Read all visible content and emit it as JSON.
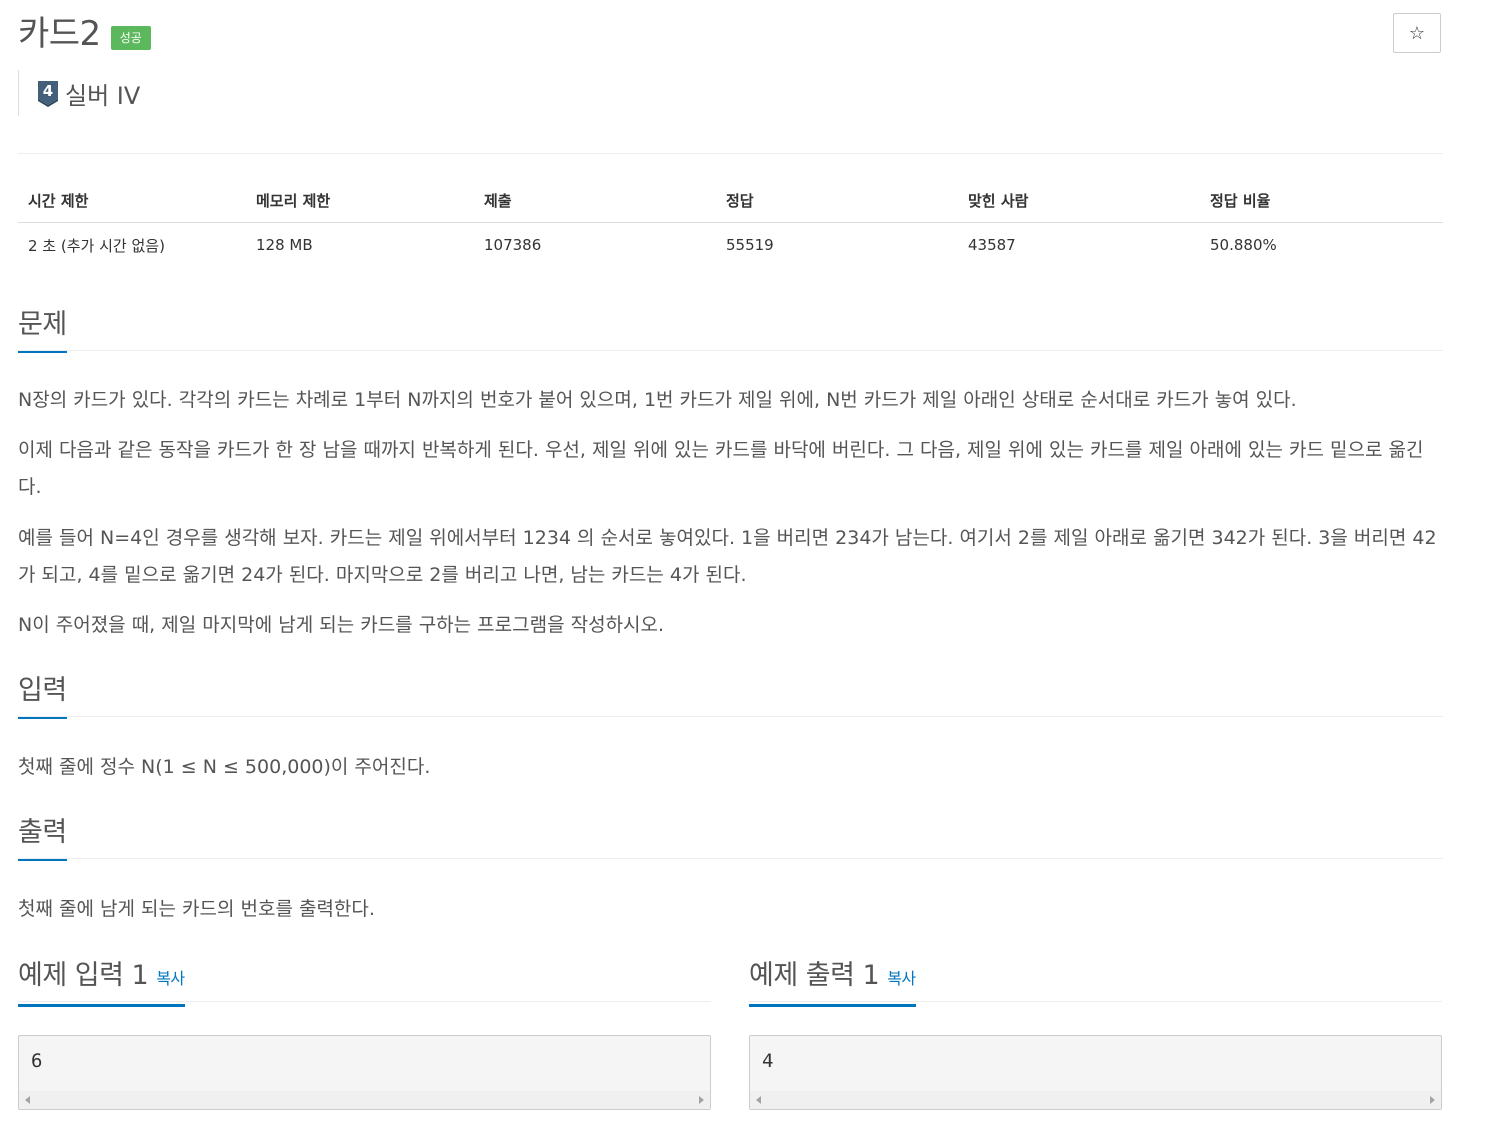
{
  "problem": {
    "title": "카드2",
    "status_badge": "성공",
    "star_icon": "☆",
    "tier": {
      "number": "4",
      "label": "실버 IV"
    }
  },
  "info_table": {
    "headers": [
      "시간 제한",
      "메모리 제한",
      "제출",
      "정답",
      "맞힌 사람",
      "정답 비율"
    ],
    "values": [
      "2 초 (추가 시간 없음)",
      "128 MB",
      "107386",
      "55519",
      "43587",
      "50.880%"
    ]
  },
  "sections": {
    "problem": {
      "title": "문제",
      "paragraphs": [
        "N장의 카드가 있다. 각각의 카드는 차례로 1부터 N까지의 번호가 붙어 있으며, 1번 카드가 제일 위에, N번 카드가 제일 아래인 상태로 순서대로 카드가 놓여 있다.",
        "이제 다음과 같은 동작을 카드가 한 장 남을 때까지 반복하게 된다. 우선, 제일 위에 있는 카드를 바닥에 버린다. 그 다음, 제일 위에 있는 카드를 제일 아래에 있는 카드 밑으로 옮긴다.",
        "예를 들어 N=4인 경우를 생각해 보자. 카드는 제일 위에서부터 1234 의 순서로 놓여있다. 1을 버리면 234가 남는다. 여기서 2를 제일 아래로 옮기면 342가 된다. 3을 버리면 42가 되고, 4를 밑으로 옮기면 24가 된다. 마지막으로 2를 버리고 나면, 남는 카드는 4가 된다.",
        "N이 주어졌을 때, 제일 마지막에 남게 되는 카드를 구하는 프로그램을 작성하시오."
      ]
    },
    "input": {
      "title": "입력",
      "text": "첫째 줄에 정수 N(1 ≤ N ≤ 500,000)이 주어진다."
    },
    "output": {
      "title": "출력",
      "text": "첫째 줄에 남게 되는 카드의 번호를 출력한다."
    }
  },
  "samples": {
    "input": {
      "title": "예제 입력 1",
      "copy_label": "복사",
      "value": "6"
    },
    "output": {
      "title": "예제 출력 1",
      "copy_label": "복사",
      "value": "4"
    }
  },
  "colors": {
    "accent": "#0076c0",
    "success": "#5cb85c",
    "tier_silver": "#435f7a"
  }
}
